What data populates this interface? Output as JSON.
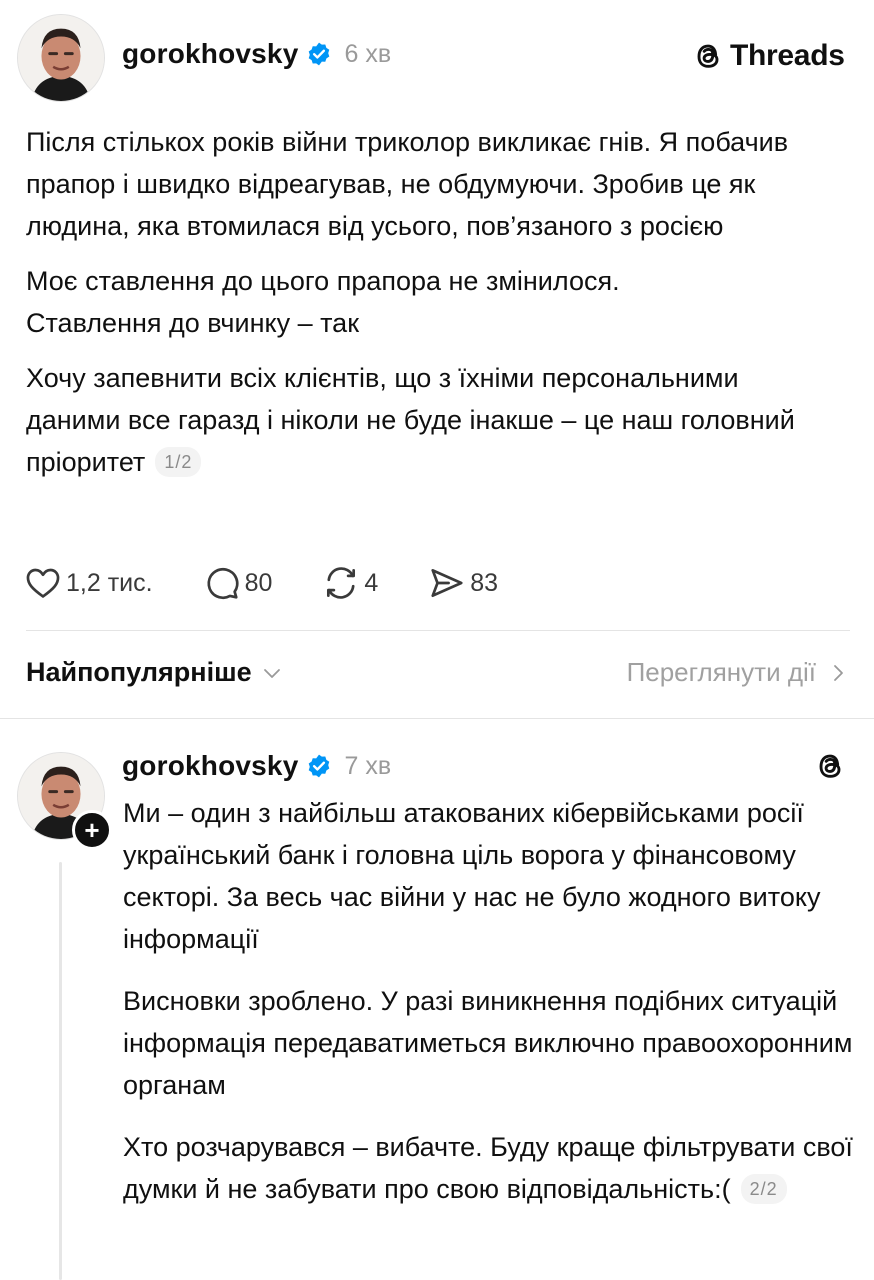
{
  "post": {
    "username": "gorokhovsky",
    "time": "6 хв",
    "brand": "Threads",
    "paragraphs": [
      "Після стількох років війни триколор викликає гнів. Я побачив прапор і швидко відреагував, не обдумуючи. Зробив це як людина, яка втомилася від усього, пов’язаного з росією",
      "Моє ставлення до цього прапора не змінилося. Ставлення до вчинку – так",
      "Хочу запевнити всіх клієнтів, що з їхніми персональними даними все гаразд і ніколи не буде інакше – це наш головний пріоритет"
    ],
    "counter": "1/2",
    "likes": "1,2 тис.",
    "replies": "80",
    "reposts": "4",
    "shares": "83"
  },
  "sort_bar": {
    "sort_label": "Найпопулярніше",
    "view_activity": "Переглянути дії"
  },
  "reply": {
    "username": "gorokhovsky",
    "time": "7 хв",
    "paragraphs": [
      "Ми – один з найбільш атакованих кібервійськами росії український банк і головна ціль ворога у фінансовому секторі. За весь час війни у нас не було жодного витоку інформації",
      "Висновки зроблено. У разі виникнення подібних ситуацій інформація передаватиметься виключно правоохоронним органам",
      "Хто розчарувався – вибачте. Буду краще фільтрувати свої думки й не забувати про свою відповідальність:("
    ],
    "counter": "2/2"
  },
  "icons": {
    "verified": "verified-badge-icon",
    "like": "heart-icon",
    "reply": "comment-icon",
    "repost": "repost-icon",
    "share": "send-icon",
    "chevron_down": "chevron-down-icon",
    "chevron_right": "chevron-right-icon",
    "threads": "threads-logo-icon",
    "follow": "plus-icon"
  },
  "colors": {
    "verified": "#0095f6",
    "text": "#101010",
    "muted": "#9a9a9a"
  }
}
